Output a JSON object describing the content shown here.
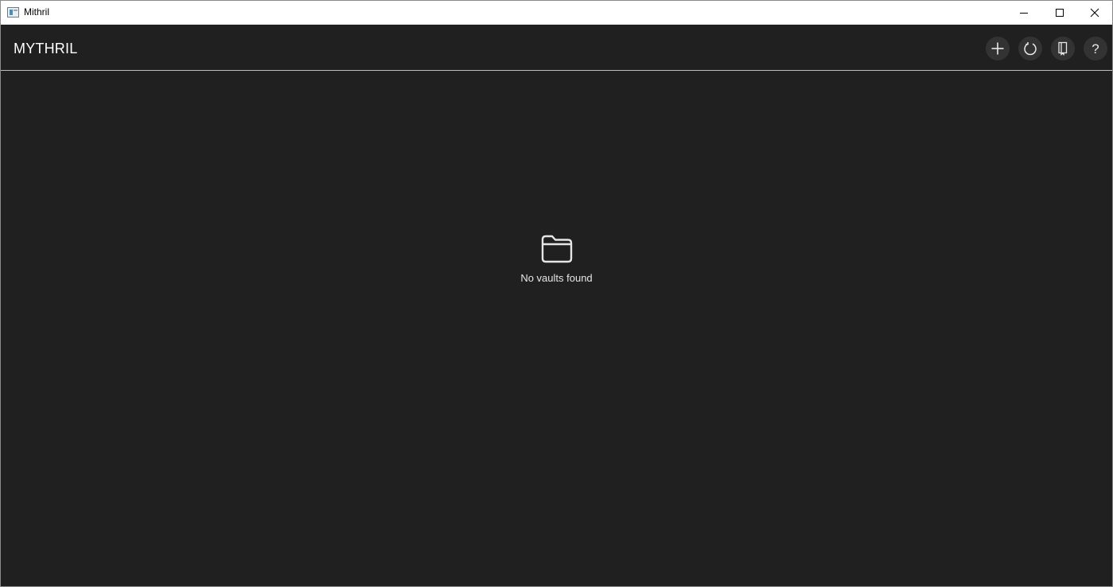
{
  "window": {
    "title": "Mithril",
    "controls": [
      "minimize-icon",
      "maximize-icon",
      "close-icon"
    ]
  },
  "header": {
    "brand": "MYTHRIL",
    "actions": [
      {
        "name": "add-vault-button",
        "icon": "plus-icon"
      },
      {
        "name": "refresh-button",
        "icon": "refresh-icon"
      },
      {
        "name": "book-button",
        "icon": "book-icon"
      },
      {
        "name": "help-button",
        "icon": "question-icon",
        "glyph": "?"
      }
    ]
  },
  "empty_state": {
    "icon": "folder-icon",
    "message": "No vaults found"
  },
  "colors": {
    "background": "#202020",
    "titlebar": "#ffffff",
    "button": "#333333",
    "text": "#ffffff"
  }
}
